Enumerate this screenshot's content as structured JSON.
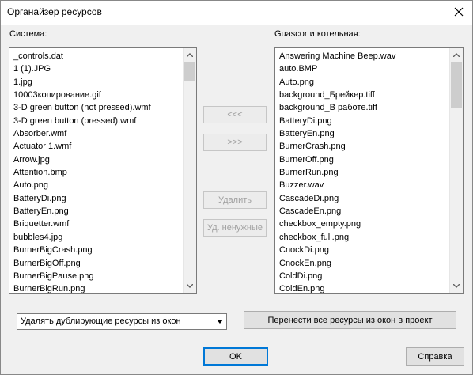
{
  "window": {
    "title": "Органайзер ресурсов"
  },
  "left_panel": {
    "label": "Система:",
    "items": [
      "_controls.dat",
      "1 (1).JPG",
      "1.jpg",
      "10003копирование.gif",
      "3-D green button (not pressed).wmf",
      "3-D green button (pressed).wmf",
      "Absorber.wmf",
      "Actuator 1.wmf",
      "Arrow.jpg",
      "Attention.bmp",
      "Auto.png",
      "BatteryDi.png",
      "BatteryEn.png",
      "Briquetter.wmf",
      "bubbles4.jpg",
      "BurnerBigCrash.png",
      "BurnerBigOff.png",
      "BurnerBigPause.png",
      "BurnerBigRun.png"
    ]
  },
  "right_panel": {
    "label": "Guascor и котельная:",
    "items": [
      "Answering Machine Beep.wav",
      "auto.BMP",
      "Auto.png",
      "background_Брейкер.tiff",
      "background_В работе.tiff",
      "BatteryDi.png",
      "BatteryEn.png",
      "BurnerCrash.png",
      "BurnerOff.png",
      "BurnerRun.png",
      "Buzzer.wav",
      "CascadeDi.png",
      "CascadeEn.png",
      "checkbox_empty.png",
      "checkbox_full.png",
      "CnockDi.png",
      "CnockEn.png",
      "ColdDi.png",
      "ColdEn.png"
    ]
  },
  "buttons": {
    "move_left": "<<<",
    "move_right": ">>>",
    "delete": "Удалить",
    "delete_unused": "Уд. ненужные",
    "transfer_all": "Перенести все ресурсы из окон в проект",
    "ok": "OK",
    "help": "Справка"
  },
  "combo": {
    "selected": "Удалять дублирующие ресурсы из окон"
  },
  "icons": {
    "close": "close-icon",
    "scroll_up": "chevron-up-icon",
    "scroll_down": "chevron-down-icon",
    "dropdown": "chevron-down-icon"
  },
  "colors": {
    "default_button_border": "#0078d7",
    "disabled_text": "#a0a0a0"
  }
}
